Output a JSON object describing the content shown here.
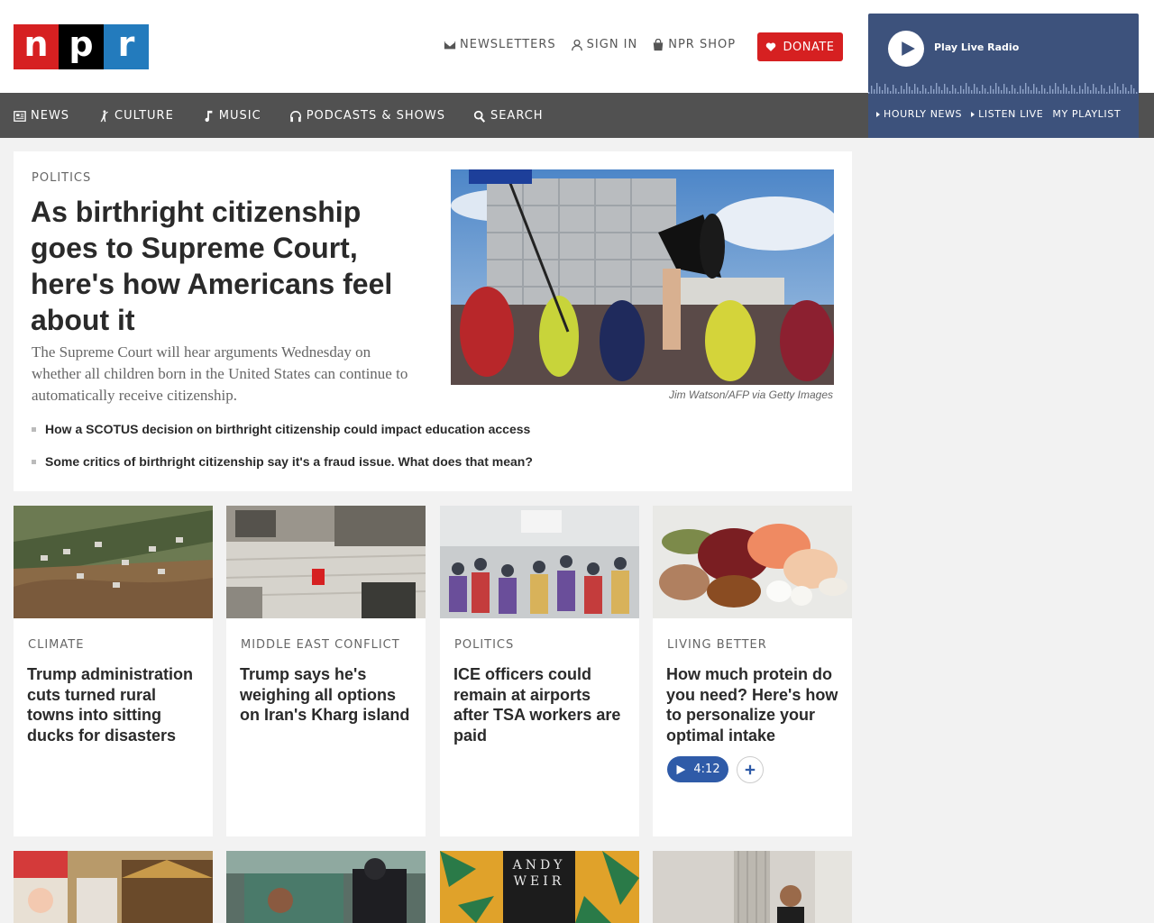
{
  "header": {
    "logo_letters": [
      "n",
      "p",
      "r"
    ],
    "logo_colors": [
      "#d62021",
      "#000000",
      "#237bbd"
    ],
    "utility": {
      "newsletters": "NEWSLETTERS",
      "sign_in": "SIGN IN",
      "shop": "NPR SHOP"
    },
    "donate": "DONATE"
  },
  "player": {
    "play_label": "Play Live Radio",
    "hourly_news": "HOURLY NEWS",
    "listen_live": "LISTEN LIVE",
    "my_playlist": "MY PLAYLIST"
  },
  "nav": {
    "news": "NEWS",
    "culture": "CULTURE",
    "music": "MUSIC",
    "podcasts": "PODCASTS & SHOWS",
    "search": "SEARCH"
  },
  "featured": {
    "slug": "POLITICS",
    "headline": "As birthright citizenship goes to Supreme Court, here's how Americans feel about it",
    "teaser": "The Supreme Court will hear arguments Wednesday on whether all children born in the United States can continue to automatically receive citizenship.",
    "credit": "Jim Watson/AFP via Getty Images",
    "related": [
      "How a SCOTUS decision on birthright citizenship could impact education access",
      "Some critics of birthright citizenship say it's a fraud issue. What does that mean?"
    ]
  },
  "stories": [
    {
      "slug": "CLIMATE",
      "title": "Trump administration cuts turned rural towns into sitting ducks for disasters"
    },
    {
      "slug": "MIDDLE EAST CONFLICT",
      "title": "Trump says he's weighing all options on Iran's Kharg island"
    },
    {
      "slug": "POLITICS",
      "title": "ICE officers could remain at airports after TSA workers are paid"
    },
    {
      "slug": "LIVING BETTER",
      "title": "How much protein do you need? Here's how to personalize your optimal intake",
      "audio_duration": "4:12"
    }
  ],
  "colors": {
    "brand_red": "#d62021",
    "player_blue": "#3d527c",
    "nav_gray": "#515151",
    "audio_blue": "#2f5ba8"
  }
}
